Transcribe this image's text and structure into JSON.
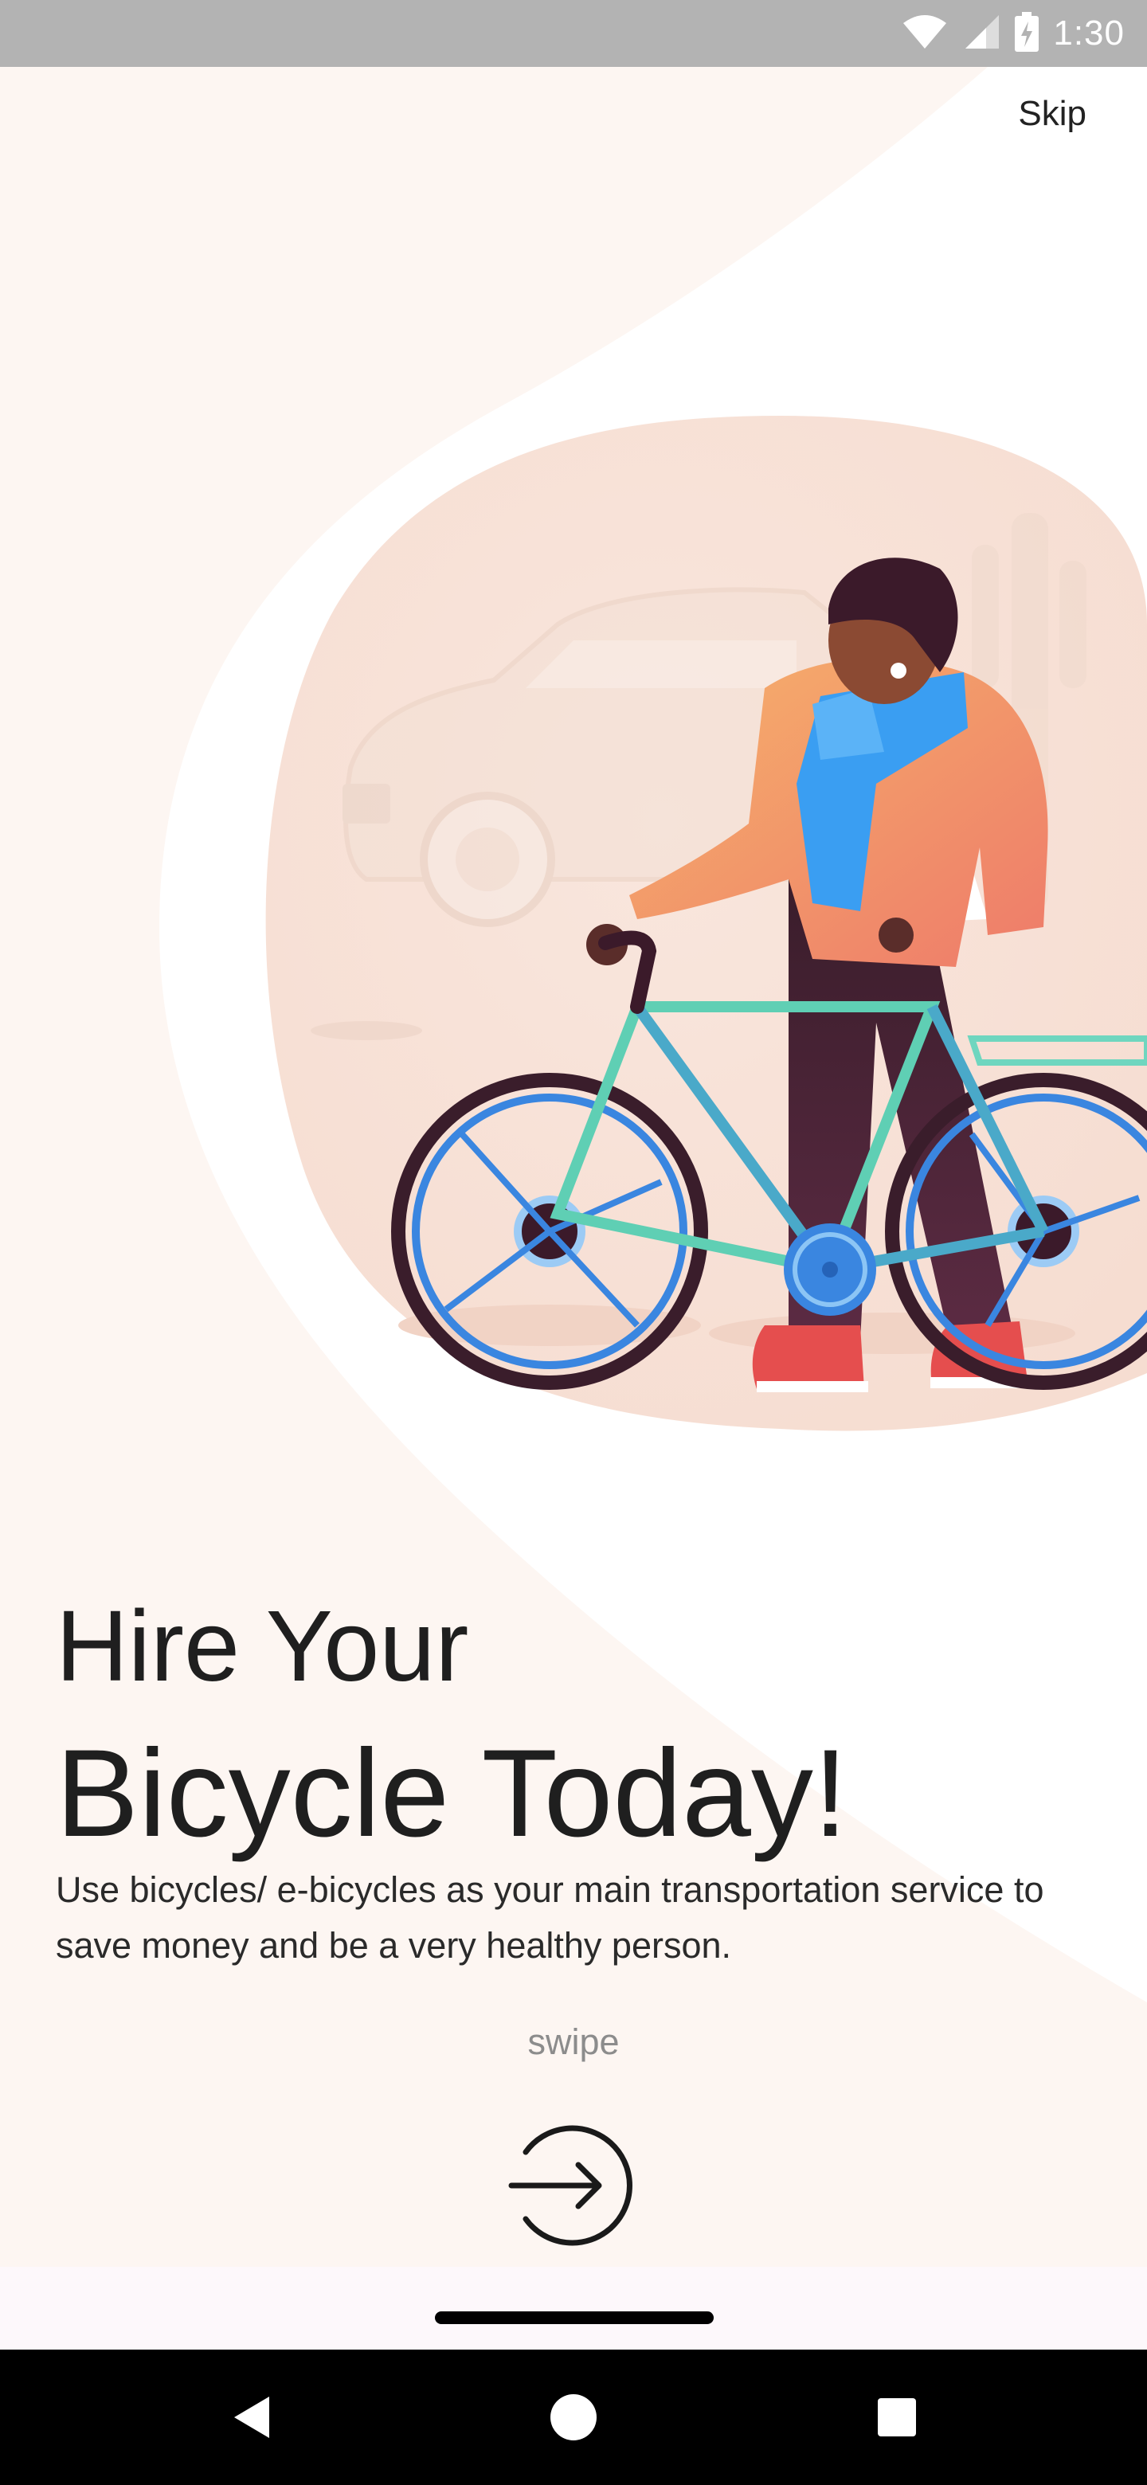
{
  "status_bar": {
    "time": "1:30",
    "icons": [
      "wifi-icon",
      "cellular-signal-icon",
      "battery-charging-icon"
    ]
  },
  "onboarding": {
    "skip_label": "Skip",
    "headline_line1": "Hire Your",
    "headline_line2": "Bicycle Today!",
    "description": "Use bicycles/ e-bicycles as your main transportation service to save money and be a very healthy person.",
    "swipe_label": "swipe",
    "next_icon": "arrow-right-circle-icon",
    "illustration": "person-with-bicycle-illustration"
  },
  "navigation": {
    "back_icon": "back-triangle-icon",
    "home_icon": "home-circle-icon",
    "recents_icon": "recents-square-icon"
  },
  "colors": {
    "background_tint": "#fdf6f2",
    "status_bar": "#b3b3b3",
    "text_primary": "#1f1f1f",
    "text_muted": "#8c8c8c"
  }
}
